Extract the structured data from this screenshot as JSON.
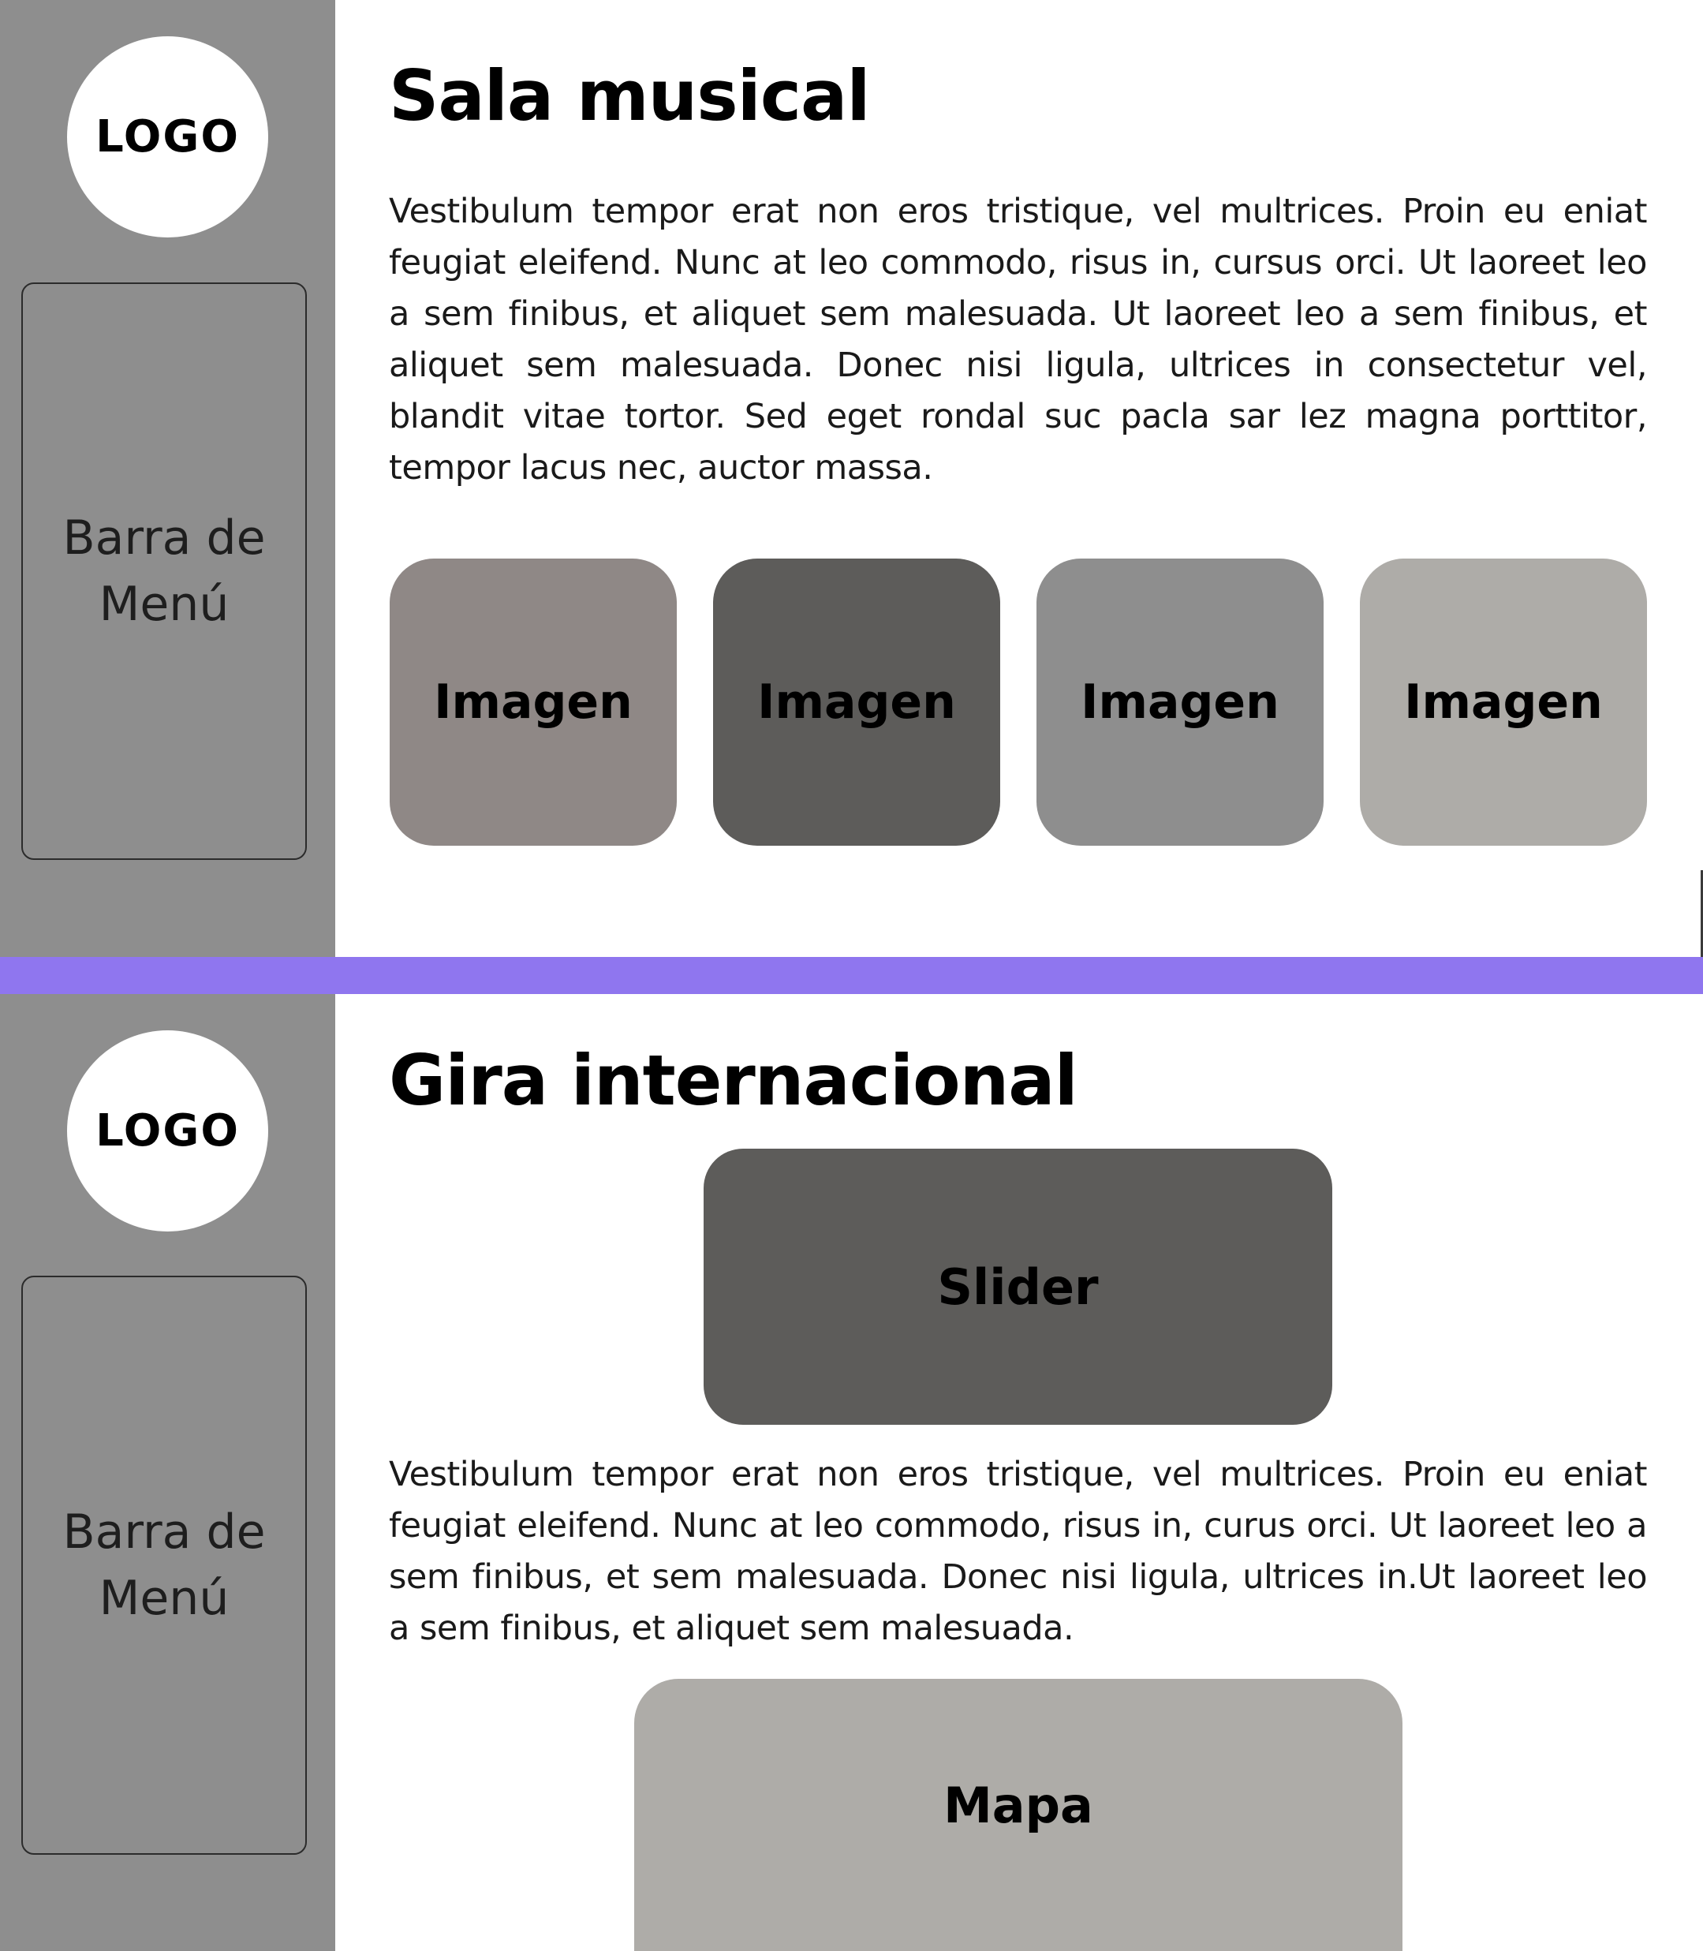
{
  "colors": {
    "sidebar": "#8e8e8e",
    "divider": "#8f76ef",
    "tile_1": "#8f8886",
    "tile_2": "#5d5c5a",
    "tile_3": "#8e8e8e",
    "tile_4": "#aeaca8",
    "slider": "#5d5c5a",
    "map": "#aeaca8"
  },
  "frame1": {
    "logo": "LOGO",
    "menu": "Barra de Menú",
    "title": "Sala musical",
    "paragraph": "Vestibulum tempor erat non eros tristique, vel multrices. Proin eu eniat feugiat eleifend. Nunc at leo commodo, risus in, cursus orci. Ut laoreet leo a sem finibus, et aliquet sem malesuada. Ut laoreet leo a sem finibus, et aliquet sem malesuada. Donec nisi ligula, ultrices in consectetur vel, blandit vitae tortor. Sed eget rondal suc pacla sar lez magna porttitor, tempor lacus nec, auctor massa.",
    "images": [
      "Imagen",
      "Imagen",
      "Imagen",
      "Imagen"
    ]
  },
  "frame2": {
    "logo": "LOGO",
    "menu": "Barra de Menú",
    "title": "Gira internacional",
    "slider": "Slider",
    "paragraph": "Vestibulum tempor erat non eros tristique, vel multrices. Proin eu eniat feugiat eleifend. Nunc at leo commodo, risus in, curus orci. Ut laoreet leo a sem finibus, et sem malesuada. Donec nisi ligula, ultrices in.Ut laoreet leo a sem finibus, et aliquet sem malesuada.",
    "map": "Mapa"
  }
}
